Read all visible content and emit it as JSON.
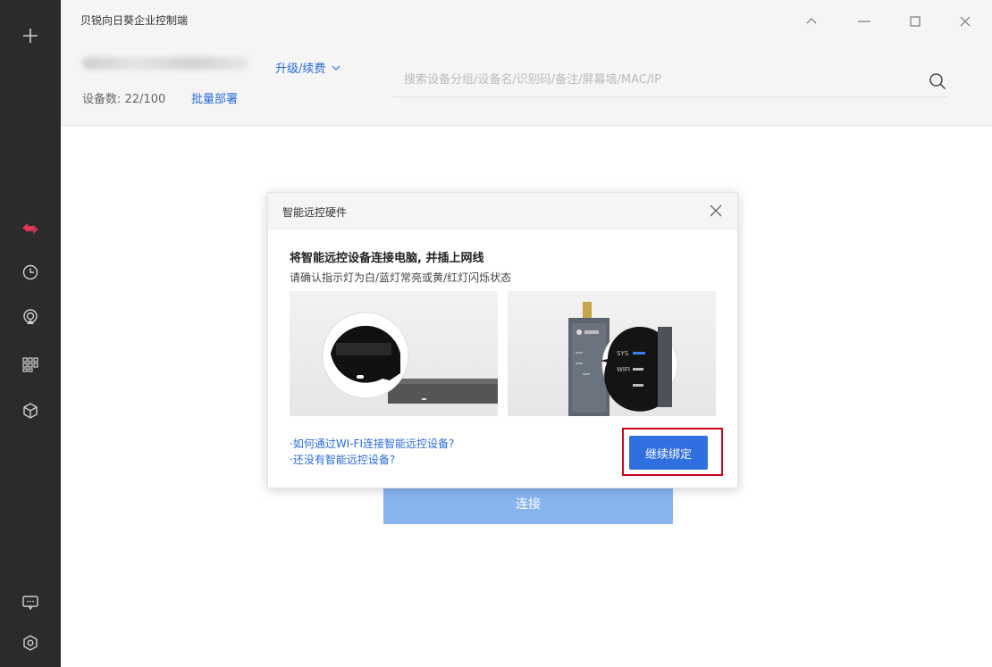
{
  "app": {
    "title": "贝锐向日葵企业控制端",
    "upgrade_label": "升级/续费",
    "device_count": "设备数: 22/100",
    "batch_deploy": "批量部署",
    "search_placeholder": "搜索设备分组/设备名/识别码/备注/屏幕墙/MAC/IP",
    "connect_button": "连接"
  },
  "modal": {
    "title": "智能远控硬件",
    "heading": "将智能远控设备连接电脑, 并插上网线",
    "subheading": "请确认指示灯为白/蓝灯常亮或黄/红灯闪烁状态",
    "link_wifi": "·如何通过WI-FI连接智能远控设备?",
    "link_no_device": "·还没有智能远控设备?",
    "continue_button": "继续绑定"
  },
  "device_image": {
    "labels": [
      "SYS",
      "WIFI"
    ]
  },
  "colors": {
    "sidebar_bg": "#2b2b2b",
    "accent": "#2f6fe0",
    "link": "#2a6bd8",
    "connect_disabled": "#88b4f0",
    "active_icon": "#e23a58",
    "highlight_border": "#d0021b"
  },
  "icons": {
    "sidebar": [
      "plus-icon",
      "remote-control-icon",
      "history-icon",
      "screen-share-icon",
      "grid-icon",
      "package-icon",
      "message-icon",
      "settings-icon"
    ],
    "window": [
      "chevron-up-icon",
      "minimize-icon",
      "maximize-icon",
      "close-icon"
    ]
  }
}
